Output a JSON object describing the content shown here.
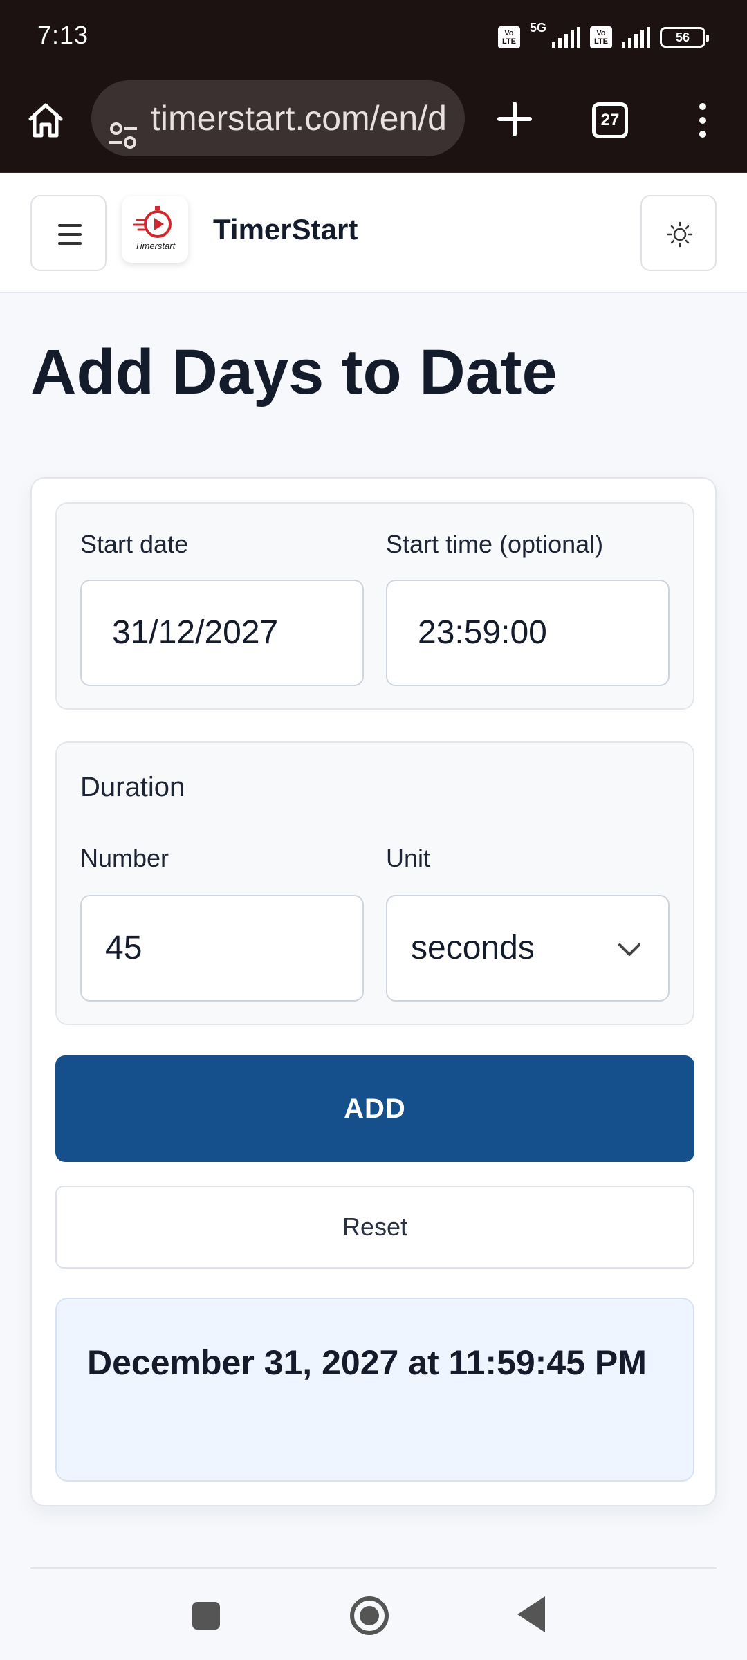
{
  "status_bar": {
    "time": "7:13",
    "network": "5G",
    "battery": "56",
    "volte_label": "Vo LTE"
  },
  "browser": {
    "url": "timerstart.com/en/d",
    "tab_count": "27",
    "icons": [
      "home-icon",
      "site-settings-icon",
      "new-tab-icon",
      "tabs-icon",
      "overflow-menu-icon"
    ]
  },
  "header": {
    "brand": "TimerStart",
    "logo_text": "Timerstart",
    "icons": [
      "hamburger-icon",
      "sun-icon"
    ]
  },
  "main": {
    "title": "Add Days to Date",
    "start_date_label": "Start date",
    "start_date_value": "31/12/2027",
    "start_time_label": "Start time (optional)",
    "start_time_value": "23:59:00",
    "duration_heading": "Duration",
    "number_label": "Number",
    "number_value": "45",
    "unit_label": "Unit",
    "unit_value": "seconds",
    "add_button": "ADD",
    "reset_button": "Reset",
    "result": "December 31, 2027 at 11:59:45 PM"
  },
  "colors": {
    "primary": "#15508c",
    "result_bg": "#eef5fe",
    "status_bar_bg": "#1c1212",
    "logo_red": "#d0282e"
  }
}
